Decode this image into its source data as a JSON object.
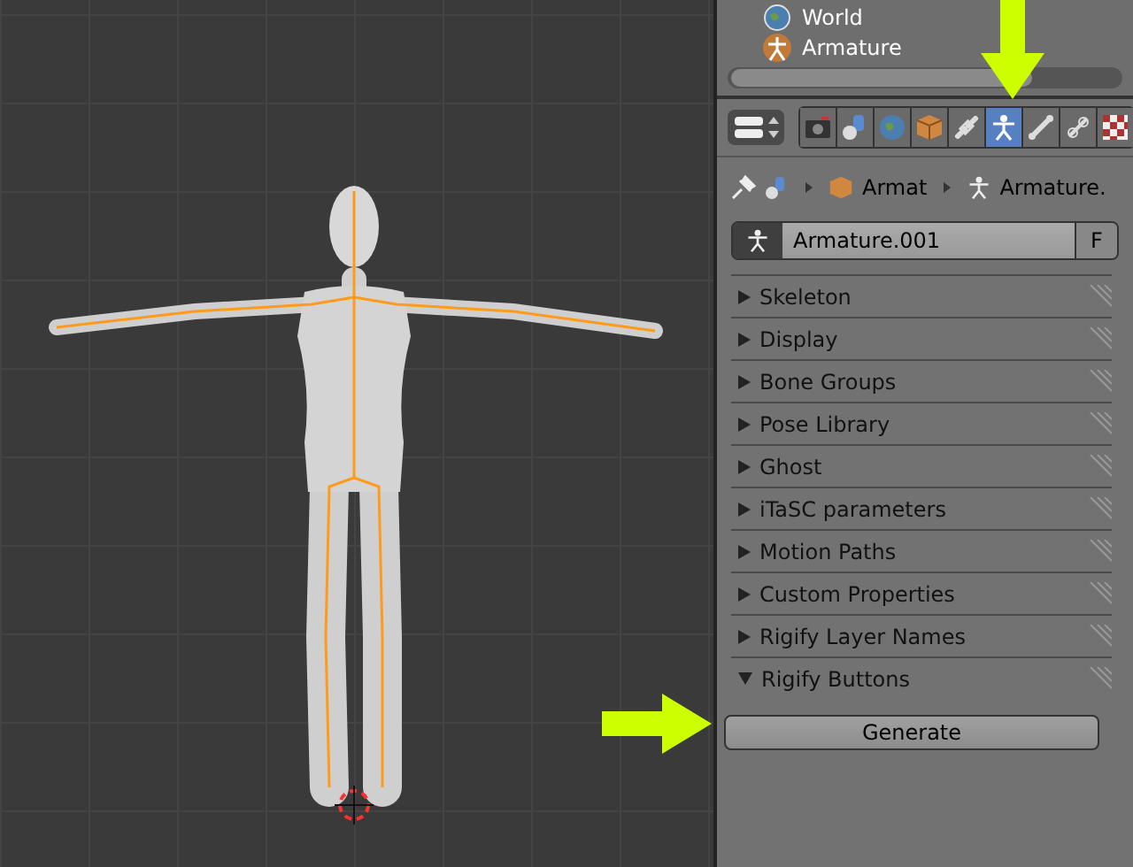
{
  "outliner": {
    "rows": [
      {
        "label": "World",
        "kind": "world"
      },
      {
        "label": "Armature",
        "kind": "armature"
      }
    ]
  },
  "property_tabs": [
    {
      "kind": "render",
      "selected": false
    },
    {
      "kind": "scene",
      "selected": false
    },
    {
      "kind": "world",
      "selected": false
    },
    {
      "kind": "object",
      "selected": false
    },
    {
      "kind": "constraint",
      "selected": false
    },
    {
      "kind": "data",
      "selected": true
    },
    {
      "kind": "bone",
      "selected": false
    },
    {
      "kind": "bone_constraint",
      "selected": false
    },
    {
      "kind": "texture",
      "selected": false
    }
  ],
  "breadcrumb": [
    "Armat",
    "Armature."
  ],
  "name_field": {
    "value": "Armature.001",
    "fake_user": "F"
  },
  "panels": [
    {
      "label": "Skeleton",
      "expanded": false
    },
    {
      "label": "Display",
      "expanded": false
    },
    {
      "label": "Bone Groups",
      "expanded": false
    },
    {
      "label": "Pose Library",
      "expanded": false
    },
    {
      "label": "Ghost",
      "expanded": false
    },
    {
      "label": "iTaSC parameters",
      "expanded": false
    },
    {
      "label": "Motion Paths",
      "expanded": false
    },
    {
      "label": "Custom Properties",
      "expanded": false
    },
    {
      "label": "Rigify Layer Names",
      "expanded": false
    },
    {
      "label": "Rigify Buttons",
      "expanded": true,
      "buttons": [
        "Generate"
      ]
    }
  ]
}
